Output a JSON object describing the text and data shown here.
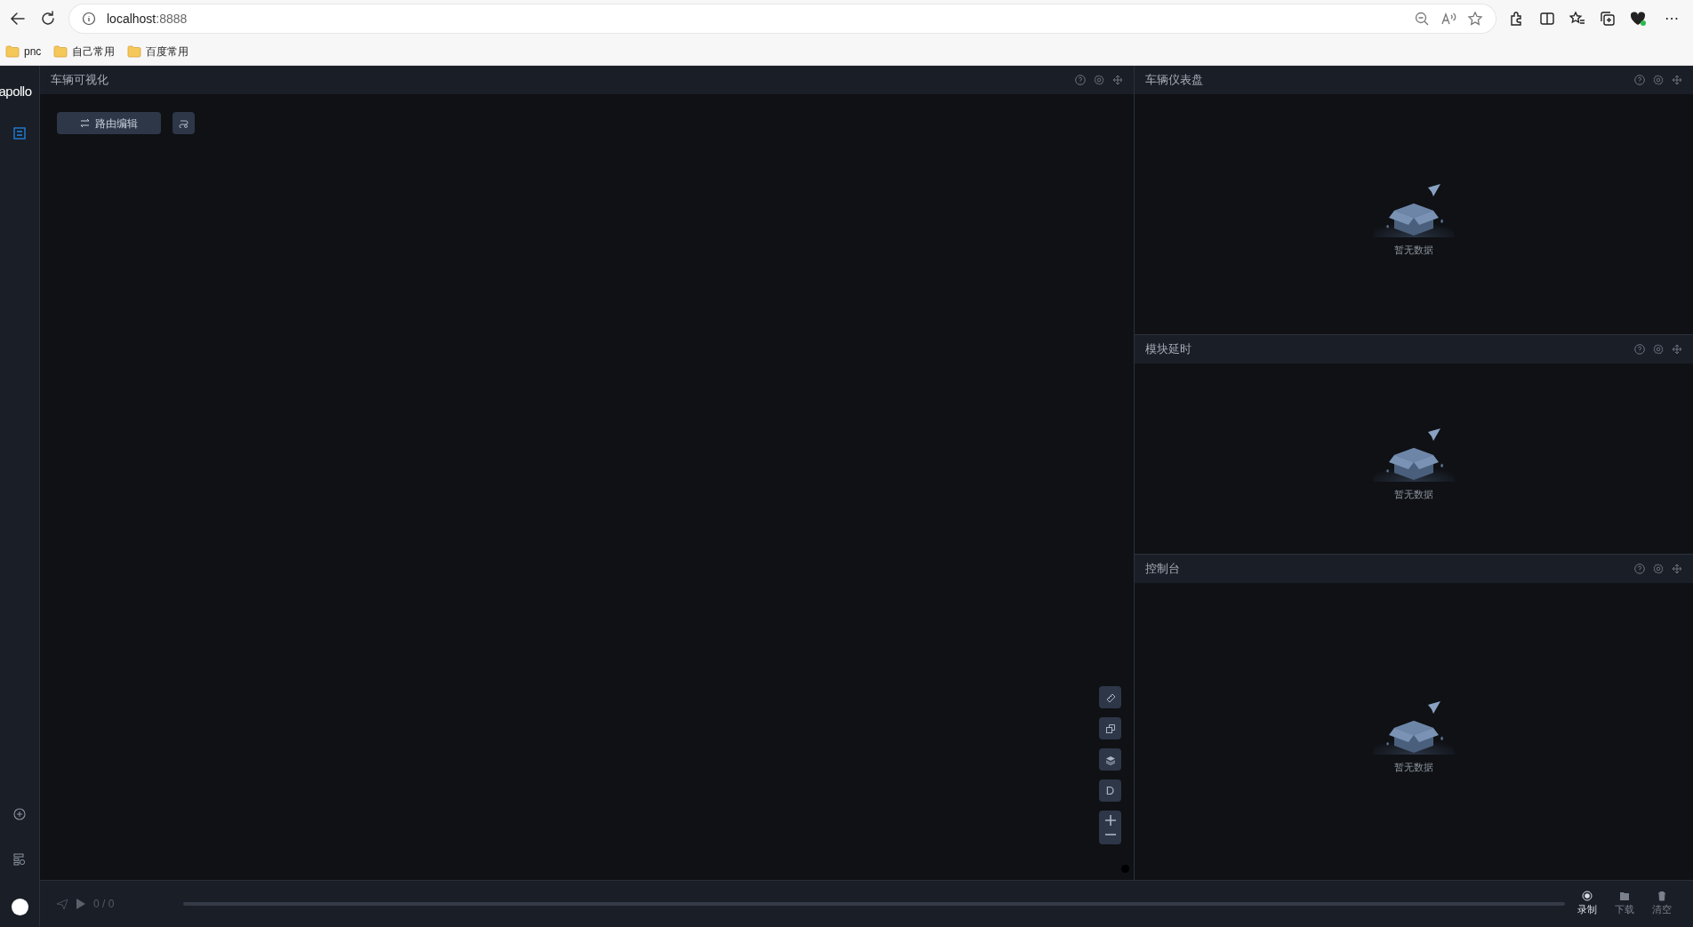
{
  "browser": {
    "url_host": "localhost",
    "url_port": ":8888",
    "more": "⋯",
    "bookmarks": [
      {
        "label": "pnc"
      },
      {
        "label": "自己常用"
      },
      {
        "label": "百度常用"
      }
    ]
  },
  "sidebar": {
    "logo": "apollo",
    "items": [
      {
        "selected": true
      }
    ],
    "bottom_items": [
      {
        "kind": "add"
      },
      {
        "kind": "settings"
      }
    ]
  },
  "visual_panel": {
    "title": "车辆可视化",
    "route_button": "路由编辑",
    "map_tools": [
      {
        "kind": "ruler"
      },
      {
        "kind": "copy"
      },
      {
        "kind": "layers"
      },
      {
        "kind": "text",
        "label": "D"
      },
      {
        "kind": "zoom"
      }
    ]
  },
  "side_panels": [
    {
      "title": "车辆仪表盘",
      "empty_text": "暂无数据"
    },
    {
      "title": "模块延时",
      "empty_text": "暂无数据"
    },
    {
      "title": "控制台",
      "empty_text": "暂无数据"
    }
  ],
  "player": {
    "counter": "0 / 0",
    "actions": [
      {
        "kind": "record",
        "label": "录制",
        "disabled": false
      },
      {
        "kind": "download",
        "label": "下载",
        "disabled": true
      },
      {
        "kind": "clear",
        "label": "清空",
        "disabled": true
      }
    ]
  }
}
